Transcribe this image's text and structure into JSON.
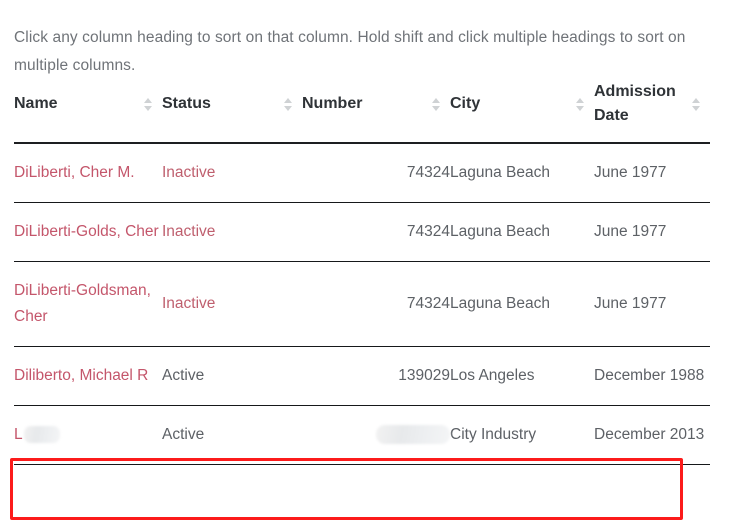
{
  "intro": {
    "text": "Click any column heading to sort on that column. Hold shift and click multiple headings to sort on multiple columns."
  },
  "table": {
    "columns": [
      {
        "key": "name",
        "label": "Name",
        "sort_icon": "sort-updown-icon"
      },
      {
        "key": "status",
        "label": "Status",
        "sort_icon": "sort-updown-icon"
      },
      {
        "key": "number",
        "label": "Number",
        "sort_icon": "sort-updown-icon"
      },
      {
        "key": "city",
        "label": "City",
        "sort_icon": "sort-updown-icon"
      },
      {
        "key": "date",
        "label": "Admission Date",
        "sort_icon": "sort-updown-icon"
      }
    ],
    "rows": [
      {
        "name": "DiLiberti, Cher M.",
        "status": "Inactive",
        "number": "74324",
        "city": "Laguna Beach",
        "date": "June 1977"
      },
      {
        "name": "DiLiberti-Golds, Cher",
        "status": "Inactive",
        "number": "74324",
        "city": "Laguna Beach",
        "date": "June 1977"
      },
      {
        "name": "DiLiberti-Goldsman, Cher",
        "status": "Inactive",
        "number": "74324",
        "city": "Laguna Beach",
        "date": "June 1977"
      },
      {
        "name": "Diliberto, Michael R",
        "status": "Active",
        "number": "139029",
        "city": "Los Angeles",
        "date": "December 1988"
      },
      {
        "name": "L",
        "name_redacted": true,
        "status": "Active",
        "number": "",
        "number_redacted": true,
        "city": "City Industry",
        "date": "December 2013"
      }
    ]
  },
  "annotation": {
    "name": "highlighted-row-box",
    "color": "#fc1b1b"
  },
  "colors": {
    "link": "#c4566b",
    "inactive_status": "#bf5f6e",
    "body_text": "#5d6166",
    "heading_text": "#2f3337",
    "intro_text": "#6f7378",
    "rule": "#16181a",
    "sort_caret": "#cfd2d4",
    "annotation": "#fc1b1b"
  }
}
